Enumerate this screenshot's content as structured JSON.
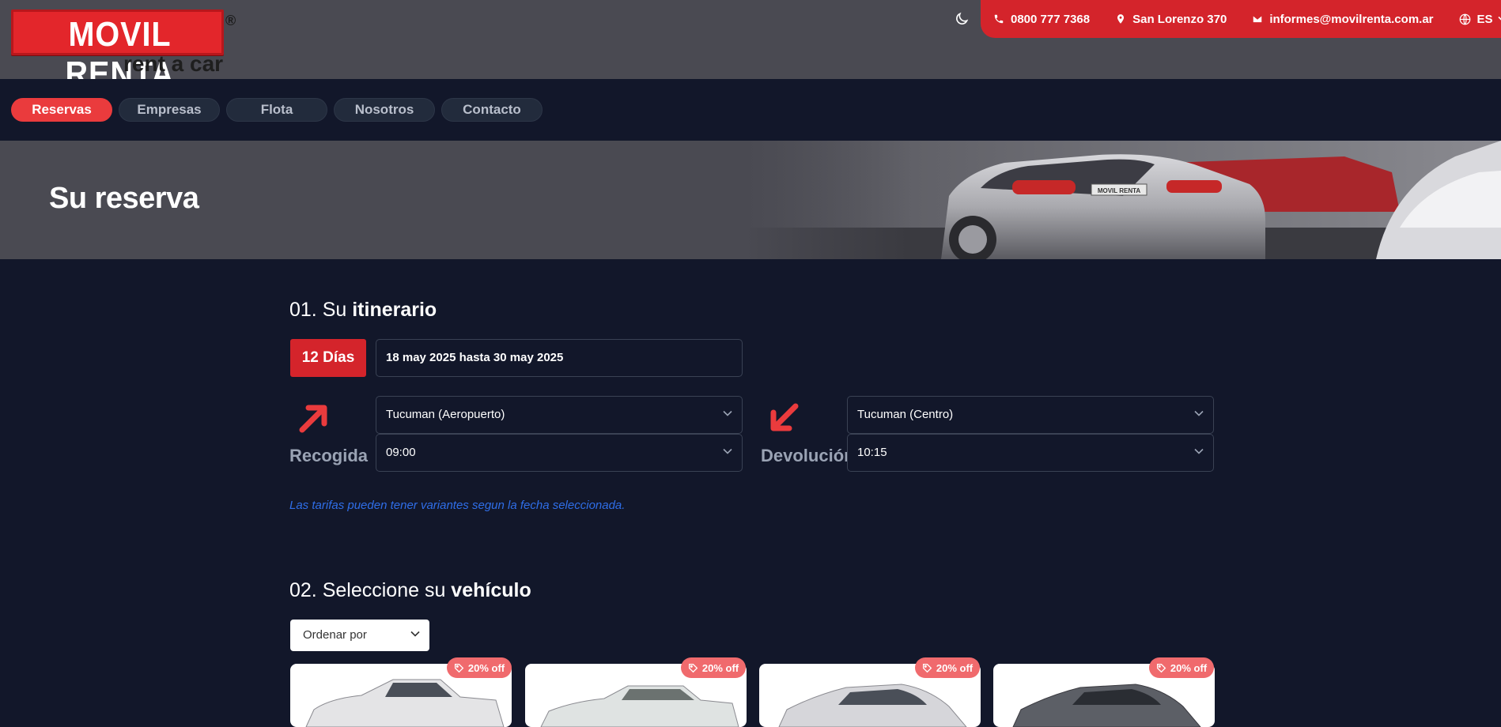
{
  "brand": {
    "name": "MOVIL RENTA",
    "registered": "®",
    "tagline": "rent a car",
    "accent_color": "#d4242b"
  },
  "header": {
    "theme_icon": "moon-icon",
    "phone": "0800 777 7368",
    "address": "San Lorenzo 370",
    "email": "informes@movilrenta.com.ar",
    "language": "ES"
  },
  "nav": {
    "items": [
      {
        "label": "Reservas",
        "active": true
      },
      {
        "label": "Empresas",
        "active": false
      },
      {
        "label": "Flota",
        "active": false
      },
      {
        "label": "Nosotros",
        "active": false
      },
      {
        "label": "Contacto",
        "active": false
      }
    ]
  },
  "hero": {
    "title": "Su reserva"
  },
  "itinerary": {
    "title_prefix": "01. Su ",
    "title_bold": "itinerario",
    "days": "12 Días",
    "date_range": "18 may 2025 hasta 30 may 2025",
    "pickup": {
      "label": "Recogida",
      "location": "Tucuman (Aeropuerto)",
      "time": "09:00"
    },
    "dropoff": {
      "label": "Devolución",
      "location": "Tucuman (Centro)",
      "time": "10:15"
    },
    "note": "Las tarifas pueden tener variantes segun la fecha seleccionada."
  },
  "vehicles": {
    "title_prefix": "02. Seleccione su ",
    "title_bold": "vehículo",
    "sort_placeholder": "Ordenar por",
    "cards": [
      {
        "discount": "20% off"
      },
      {
        "discount": "20% off"
      },
      {
        "discount": "20% off"
      },
      {
        "discount": "20% off"
      }
    ]
  }
}
